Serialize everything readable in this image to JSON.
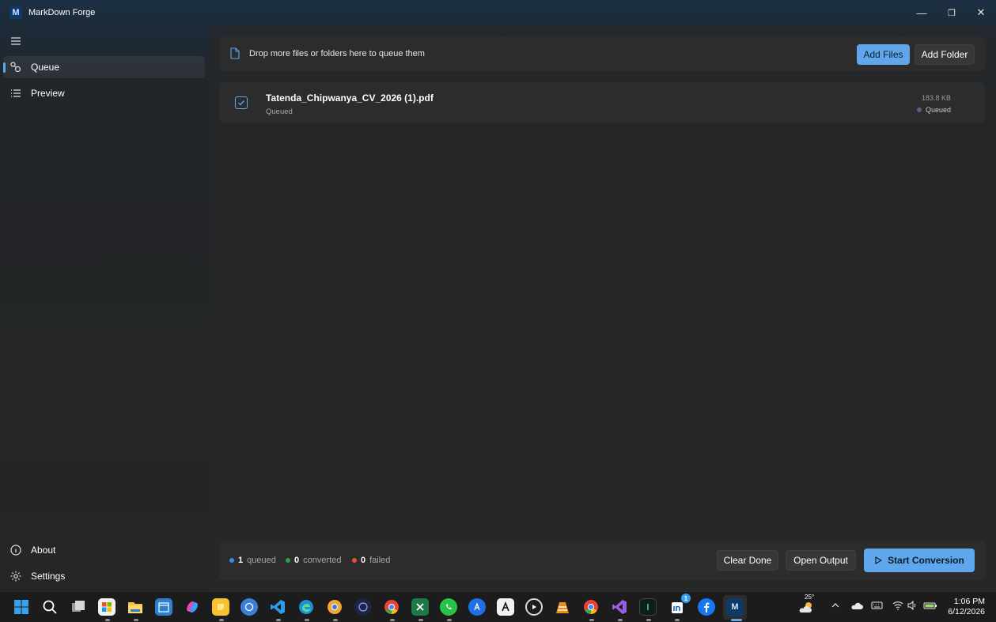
{
  "app": {
    "title": "MarkDown Forge",
    "logo_letter": "M"
  },
  "window_controls": {
    "minimize": "—",
    "maximize": "❐",
    "close": "✕"
  },
  "sidebar": {
    "items": [
      {
        "label": "Queue",
        "icon": "queue-icon",
        "active": true
      },
      {
        "label": "Preview",
        "icon": "list-icon",
        "active": false
      }
    ],
    "bottom_items": [
      {
        "label": "About",
        "icon": "info-icon"
      },
      {
        "label": "Settings",
        "icon": "gear-icon"
      }
    ]
  },
  "dropzone": {
    "text": "Drop more files or folders here to queue them",
    "add_files_label": "Add Files",
    "add_folder_label": "Add Folder"
  },
  "queue": {
    "files": [
      {
        "name": "Tatenda_Chipwanya_CV_2026 (1).pdf",
        "status": "Queued",
        "size": "183.8 KB",
        "badge": "Queued",
        "checked": true
      }
    ]
  },
  "footer": {
    "stats": [
      {
        "count": "1",
        "label": "queued",
        "color": "#3b8ee0"
      },
      {
        "count": "0",
        "label": "converted",
        "color": "#2ea043"
      },
      {
        "count": "0",
        "label": "failed",
        "color": "#e5532b"
      }
    ],
    "clear_done_label": "Clear Done",
    "open_output_label": "Open Output",
    "start_conversion_label": "Start Conversion"
  },
  "taskbar": {
    "weather_temp": "25°",
    "linkedin_badge": "1",
    "time": "1:06 PM",
    "date": "6/12/2026"
  },
  "colors": {
    "accent": "#5fa7ea",
    "surface": "#2c2c2c",
    "background": "#202020"
  }
}
